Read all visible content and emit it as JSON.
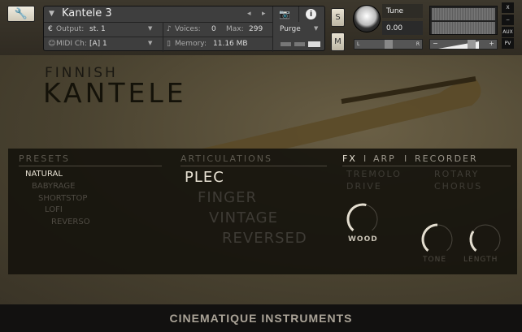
{
  "header": {
    "instrument_name": "Kantele 3",
    "output_label": "Output:",
    "output_value": "st. 1",
    "midi_label": "MIDI Ch:",
    "midi_value": "[A]  1",
    "voices_label": "Voices:",
    "voices_value": "0",
    "max_label": "Max:",
    "max_value": "299",
    "memory_label": "Memory:",
    "memory_value": "11.16 MB",
    "purge_label": "Purge",
    "solo_label": "S",
    "mute_label": "M",
    "tune_label": "Tune",
    "tune_value": "0.00",
    "pan_left": "L",
    "pan_right": "R",
    "vol_minus": "−",
    "vol_plus": "+",
    "close_label": "X",
    "minimize_label": "−",
    "aux_label": "AUX",
    "pv_label": "PV"
  },
  "title": {
    "line1": "FINNISH",
    "line2": "KANTELE"
  },
  "presets": {
    "heading": "PRESETS",
    "items": [
      "NATURAL",
      "BABYRAGE",
      "SHORTSTOP",
      "LOFI",
      "REVERSO"
    ],
    "selected": "NATURAL"
  },
  "articulations": {
    "heading": "ARTICULATIONS",
    "items": [
      "PLEC",
      "FINGER",
      "VINTAGE",
      "REVERSED"
    ],
    "selected": "PLEC"
  },
  "fx": {
    "tabs": [
      "FX",
      "ARP",
      "RECORDER"
    ],
    "divider": "I",
    "items": [
      "TREMOLO",
      "ROTARY",
      "DRIVE",
      "CHORUS"
    ],
    "knobs": [
      {
        "label": "WOOD",
        "value": 0.55
      },
      {
        "label": "TONE",
        "value": 0.5
      },
      {
        "label": "LENGTH",
        "value": 0.3
      }
    ]
  },
  "footer": {
    "brand": "CINEMATIQUE INSTRUMENTS"
  },
  "colors": {
    "selected": "#e8e2d4",
    "inactive": "#4f4b43",
    "panel": "#16130d"
  }
}
